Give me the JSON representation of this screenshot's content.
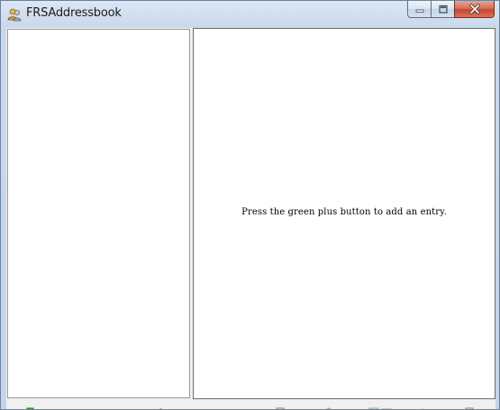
{
  "window": {
    "title": "FRSAddressbook",
    "app_icon": "addressbook-people-icon"
  },
  "caption_buttons": {
    "minimize_icon": "minimize-icon",
    "maximize_icon": "maximize-icon",
    "close_icon": "close-icon"
  },
  "right_pane": {
    "empty_message": "Press the green plus button to add an entry."
  },
  "toolbar": {
    "items": [
      {
        "name": "add-entry-button",
        "icon": "green-plus-icon",
        "color": "#2aa22a"
      },
      {
        "name": "edit-entry-button",
        "icon": "pencil-icon"
      },
      {
        "name": "checkbox-button",
        "icon": "checkbox-icon"
      },
      {
        "name": "navigate-button",
        "icon": "arrow-icon"
      },
      {
        "name": "mail-button",
        "icon": "envelope-icon"
      },
      {
        "name": "print-button",
        "icon": "printer-icon"
      },
      {
        "name": "search-button",
        "icon": "magnifier-icon"
      },
      {
        "name": "settings-button",
        "icon": "settings-icon"
      }
    ]
  },
  "colors": {
    "title_bar": "#c9d9ec",
    "close_button": "#c7452b",
    "pane_background": "#ffffff"
  }
}
